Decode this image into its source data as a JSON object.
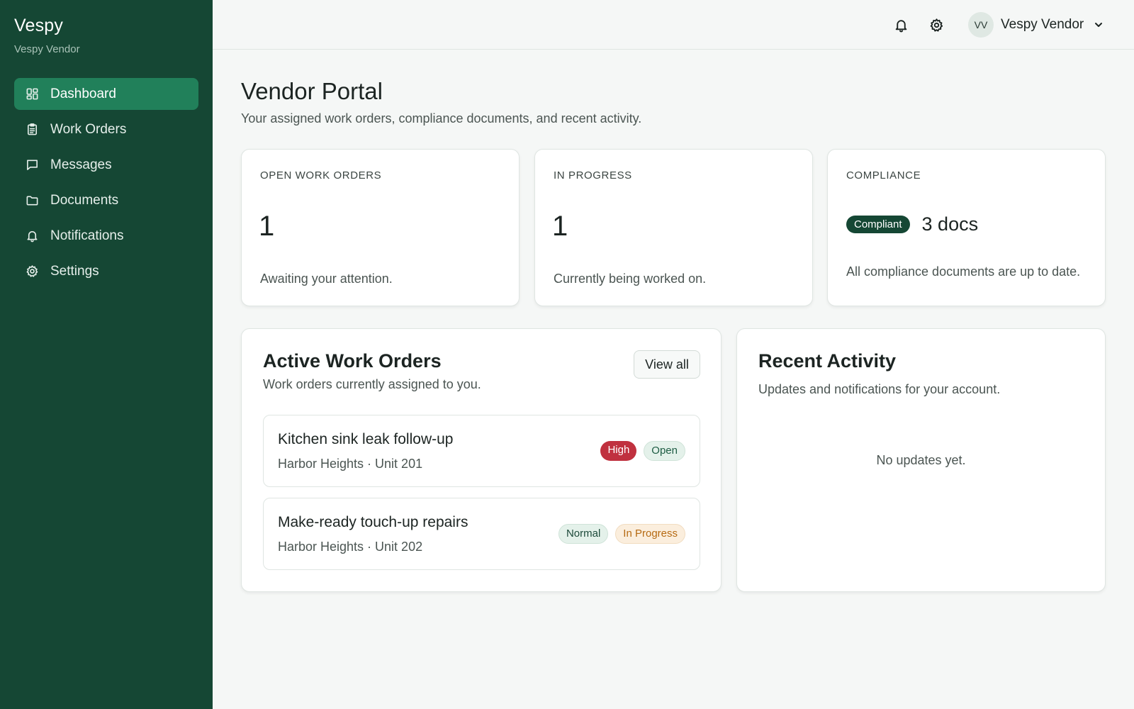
{
  "brand": {
    "name": "Vespy",
    "subtitle": "Vespy Vendor"
  },
  "sidebar": {
    "items": [
      {
        "label": "Dashboard",
        "icon": "dashboard-icon",
        "active": true
      },
      {
        "label": "Work Orders",
        "icon": "clipboard-icon",
        "active": false
      },
      {
        "label": "Messages",
        "icon": "message-icon",
        "active": false
      },
      {
        "label": "Documents",
        "icon": "folder-icon",
        "active": false
      },
      {
        "label": "Notifications",
        "icon": "bell-icon",
        "active": false
      },
      {
        "label": "Settings",
        "icon": "gear-icon",
        "active": false
      }
    ]
  },
  "topbar": {
    "icons": [
      "bell-icon",
      "gear-icon"
    ],
    "user": {
      "initials": "VV",
      "name": "Vespy Vendor"
    }
  },
  "page": {
    "title": "Vendor Portal",
    "subtitle": "Your assigned work orders, compliance documents, and recent activity."
  },
  "stats": {
    "open": {
      "label": "OPEN WORK ORDERS",
      "value": "1",
      "note": "Awaiting your attention."
    },
    "in_progress": {
      "label": "IN PROGRESS",
      "value": "1",
      "note": "Currently being worked on."
    },
    "compliance": {
      "label": "COMPLIANCE",
      "badge": "Compliant",
      "docs": "3 docs",
      "note": "All compliance documents are up to date."
    }
  },
  "active_work_orders": {
    "title": "Active Work Orders",
    "subtitle": "Work orders currently assigned to you.",
    "view_all_label": "View all",
    "items": [
      {
        "title": "Kitchen sink leak follow-up",
        "location": "Harbor Heights · Unit 201",
        "priority": "High",
        "status": "Open"
      },
      {
        "title": "Make-ready touch-up repairs",
        "location": "Harbor Heights · Unit 202",
        "priority": "Normal",
        "status": "In Progress"
      }
    ]
  },
  "recent_activity": {
    "title": "Recent Activity",
    "subtitle": "Updates and notifications for your account.",
    "empty_text": "No updates yet."
  },
  "colors": {
    "sidebar_bg": "#154734",
    "nav_active_bg": "#21805a",
    "page_bg": "#f5f7f6",
    "badge_high": "#c0313f",
    "badge_inprogress_text": "#b66a12"
  }
}
